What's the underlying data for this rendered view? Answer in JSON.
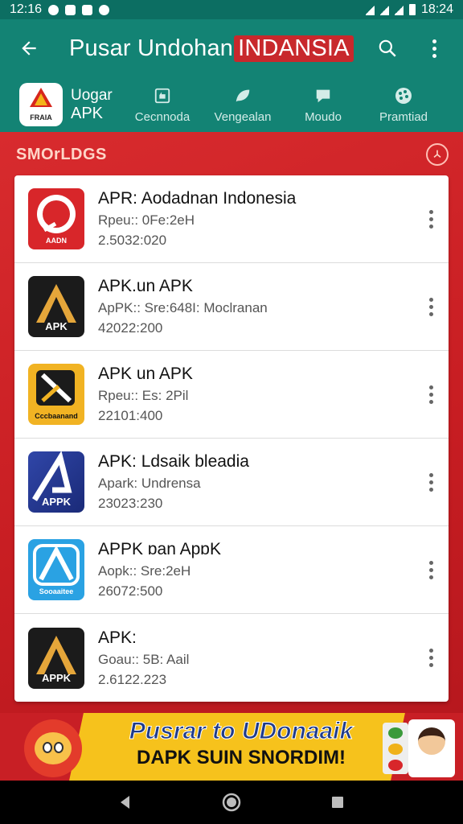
{
  "status_bar": {
    "time_left": "12:16",
    "time_right": "18:24"
  },
  "app_bar": {
    "title_main": "Pusar Undohan",
    "title_highlight": "INDANSIA",
    "brand_logo_text": "FRAIA",
    "brand_line1": "Uogar",
    "brand_line2": "APK",
    "categories": [
      {
        "label": "Cecnnoda",
        "icon": "thumbs-up-icon"
      },
      {
        "label": "Vengealan",
        "icon": "leaf-icon"
      },
      {
        "label": "Moudo",
        "icon": "speech-bubble-icon"
      },
      {
        "label": "Pramtiad",
        "icon": "palette-icon"
      }
    ]
  },
  "section": {
    "title": "SMOrLDGS",
    "action_icon": "compass-icon"
  },
  "apps": [
    {
      "title": "APR: Aodadnan Indonesia",
      "subtitle": "Rpeu:: 0Fe:2eH",
      "meta": "2.5032:020",
      "icon_caption": "AADN",
      "icon_bg": "#d8262a"
    },
    {
      "title": "APK.un APK",
      "subtitle": "ApPK:: Sre:648I: Moclranan",
      "meta": "42022:200",
      "icon_caption": "APK",
      "icon_bg": "#1b1b1b"
    },
    {
      "title": "APK un APK",
      "subtitle": "Rpeu:: Es: 2Pil",
      "meta": "22101:400",
      "icon_caption": "Cccbaanand",
      "icon_bg": "#f1b323"
    },
    {
      "title": "APK: Ldsaik bleadia",
      "subtitle": "Apark: Undrensa",
      "meta": "23023:230",
      "icon_caption": "APPK",
      "icon_bg": "#2c3b91"
    },
    {
      "title": "APPK ɒan ApɒK",
      "subtitle": "Aopk:: Sre:2eH",
      "meta": "26072:500",
      "icon_caption": "Sooaaitee",
      "icon_bg": "#2aa2e3"
    },
    {
      "title": "APK:",
      "subtitle": "Goau:: 5B: Aail",
      "meta": "2.6122.223",
      "icon_caption": "APPK",
      "icon_bg": "#1b1b1b"
    }
  ],
  "banner": {
    "line1": "Pusrar to UDonaaik",
    "line2": "DAPK SUIN SNORDIM!"
  },
  "colors": {
    "header": "#138374",
    "status_bar": "#0c6e62",
    "background": "#c81f25",
    "banner_yellow": "#f6c21c"
  }
}
